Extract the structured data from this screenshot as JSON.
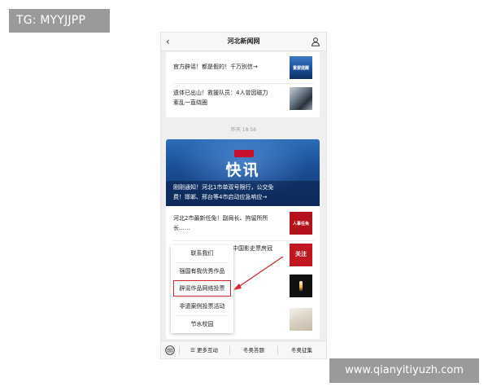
{
  "watermarks": {
    "top_left": "TG: MYYJJPP",
    "bottom_right": "www.qianyitiyuzh.com"
  },
  "nav": {
    "back_icon": "chevron-left-icon",
    "title": "河北新闻网",
    "profile_icon": "person-icon"
  },
  "card1": {
    "items": [
      {
        "title": "官方辟谣！都是假的！千万别信→",
        "thumb_caption": "重要提醒"
      },
      {
        "title_line1": "遗体已出山！救援队员：4人曾因磁力",
        "title_line2": "紊乱一直绕圈"
      }
    ]
  },
  "timestamp": "昨天 18:56",
  "card2": {
    "banner": {
      "big_text": "快讯",
      "caption_line1": "刚刚通知！河北1市单双号限行，公交免",
      "caption_line2": "费！邯郸、邢台等4市启动应急响应→"
    },
    "items": [
      {
        "title_line1": "河北2市最新任免！副局长、拘留所所",
        "title_line2": "长……",
        "thumb_caption": "人事任免"
      },
      {
        "title_partial": "中国影史票房冠",
        "thumb_caption": "关注"
      }
    ]
  },
  "menu": {
    "items": [
      {
        "label": "联系我们"
      },
      {
        "label": "强国有我优秀作品"
      },
      {
        "label": "辟谣作品网络投票",
        "highlighted": true
      },
      {
        "label": "非遗案例投票活动"
      },
      {
        "label": "节水校园"
      }
    ],
    "highlight_color": "#d2242b"
  },
  "tabbar": {
    "keyboard_icon": "keyboard-icon",
    "tabs": [
      {
        "label": "更多互动",
        "menu_glyph": "☰"
      },
      {
        "label": "冬奥答题"
      },
      {
        "label": "冬奥征集"
      }
    ]
  },
  "colors": {
    "accent_red": "#d2242b",
    "banner_blue": "#1b4d93"
  }
}
